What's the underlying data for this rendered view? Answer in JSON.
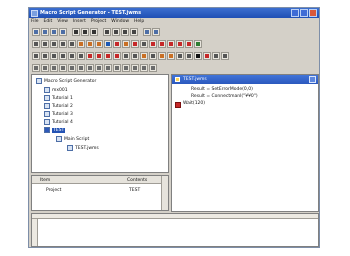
{
  "window": {
    "title": "Macro Script Generator - TEST.jwms",
    "menu": [
      "File",
      "Edit",
      "View",
      "Insert",
      "Project",
      "Window",
      "Help"
    ]
  },
  "tree": {
    "items": [
      {
        "label": "Macro Script Generator"
      },
      {
        "label": "mx001"
      },
      {
        "label": "Tutorial 1"
      },
      {
        "label": "Tutorial 2"
      },
      {
        "label": "Tutorial 3"
      },
      {
        "label": "Tutorial 4"
      },
      {
        "label": "TEST"
      },
      {
        "label": "Main Script"
      },
      {
        "label": "TEST.jwms"
      }
    ]
  },
  "properties": {
    "columns": [
      "Item",
      "Contents"
    ],
    "rows": [
      {
        "item": "Project",
        "contents": "TEST"
      }
    ]
  },
  "editor": {
    "tab_title": "TEST.jwms",
    "lines": [
      "Result = SetErrorMode(0,0)",
      "Result = Connectmanl(\"¥¥0\")",
      "Wait(120)"
    ]
  },
  "colors": {
    "title_bar": "#2453b4",
    "panel": "#d4d0c8",
    "selection": "#2453b4"
  },
  "icons": {
    "toolbar_rows": [
      [
        "new-icon",
        "open-icon",
        "save-icon",
        "print-icon",
        "cut-icon",
        "copy-icon",
        "paste-icon",
        "undo-icon",
        "redo-icon",
        "find-icon",
        "replace-icon",
        "window-icon",
        "help-icon"
      ],
      [
        "grid-icon",
        "image-icon",
        "camera-icon",
        "mouse-icon",
        "tool-icon",
        "chart-icon",
        "text-icon",
        "table-icon",
        "bar-chart-icon",
        "arrow-icon",
        "list-icon",
        "run-icon",
        "plot-icon",
        "text-a-icon",
        "text-b-icon",
        "text-c-icon",
        "text-d-icon",
        "text-e-icon",
        "text-f-icon"
      ],
      [
        "monitor-icon",
        "monitor-alt-icon",
        "tool-a-icon",
        "tool-b-icon",
        "layout-icon",
        "edit-icon",
        "pointer-icon",
        "start-icon",
        "stop-icon",
        "record-icon",
        "square-icon",
        "settings-icon",
        "wand-icon",
        "layer-icon",
        "shape-icon",
        "color-icon",
        "sound-icon",
        "bar-icon",
        "square-dark-icon",
        "flag-icon",
        "pin-icon",
        "tools-icon"
      ],
      [
        "form-icon",
        "form-alt-icon",
        "window-a-icon",
        "window-b-icon",
        "table-icon-2",
        "list-icon-2",
        "frame-icon",
        "panel-icon",
        "tile-a-icon",
        "tile-b-icon",
        "tile-c-icon",
        "tile-d-icon",
        "tile-e-icon",
        "tile-f-icon"
      ]
    ]
  }
}
